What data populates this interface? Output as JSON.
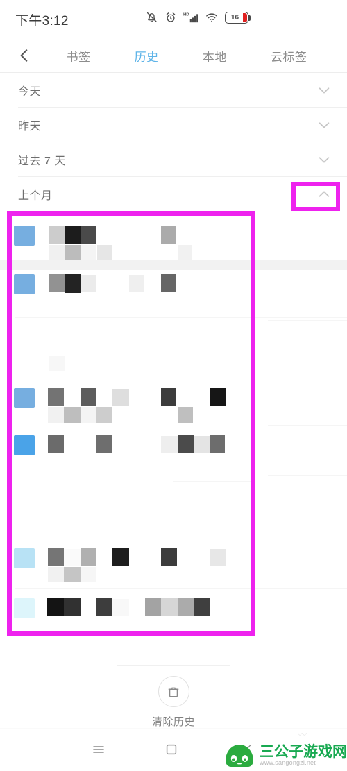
{
  "statusbar": {
    "time": "下午3:12",
    "battery_level": "16",
    "icons": [
      "bell-muted-icon",
      "alarm-clock-icon",
      "hd-signal-icon",
      "wifi-icon",
      "battery-icon"
    ]
  },
  "tabbar": {
    "back_icon": "back-chevron-icon",
    "tabs": [
      {
        "label": "书签",
        "active": false
      },
      {
        "label": "历史",
        "active": true
      },
      {
        "label": "本地",
        "active": false
      },
      {
        "label": "云标签",
        "active": false
      }
    ],
    "active_color": "#5fb4e8",
    "inactive_color": "#8d8d8d"
  },
  "sections": [
    {
      "label": "今天",
      "expanded": false,
      "chevron": "chevron-down-icon"
    },
    {
      "label": "昨天",
      "expanded": false,
      "chevron": "chevron-down-icon"
    },
    {
      "label": "过去 7 天",
      "expanded": false,
      "chevron": "chevron-down-icon"
    },
    {
      "label": "上个月",
      "expanded": true,
      "chevron": "chevron-up-icon"
    }
  ],
  "highlights": {
    "color": "#ee22ee",
    "chevron_box_label": "上个月 折叠箭头高亮框",
    "list_box_label": "上个月历史记录列表高亮框"
  },
  "history_list": {
    "censored": true,
    "note": "内容已马赛克处理",
    "rows": [
      {
        "favicon_color": "#76aee0",
        "line1_blocks": 4,
        "line2_blocks": 4
      },
      {
        "favicon_color": "#76aee0",
        "line1_blocks": 5,
        "line2_blocks": 0
      },
      {
        "favicon_color": "#76aee0",
        "line1_blocks": 6,
        "line2_blocks": 4
      },
      {
        "favicon_color": "#4aa3e8",
        "line1_blocks": 5,
        "line2_blocks": 0
      },
      {
        "favicon_color": "#b8e2f5",
        "line1_blocks": 6,
        "line2_blocks": 3
      },
      {
        "favicon_color": "#ddf5fb",
        "line1_blocks": 7,
        "line2_blocks": 0
      }
    ]
  },
  "footer": {
    "clear_icon": "trash-icon",
    "clear_label": "清除历史"
  },
  "navbar": {
    "menu_icon": "hamburger-menu-icon",
    "home_icon": "square-recents-icon",
    "back_icon": "nav-back-chevron-icon"
  },
  "watermark": {
    "title": "三公子游戏网",
    "url": "www.sangongzi.net",
    "logo_icon": "green-frog-logo-icon",
    "color": "#18a951"
  }
}
